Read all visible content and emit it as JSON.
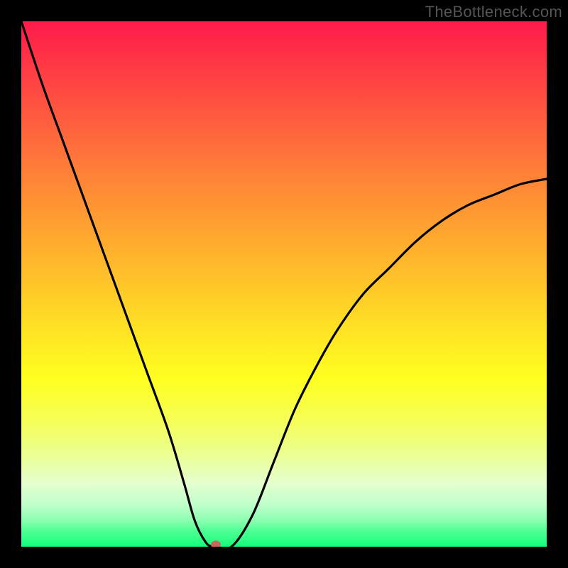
{
  "watermark": "TheBottleneck.com",
  "colors": {
    "frame_bg": "#000000",
    "curve_stroke": "#000000",
    "dot_fill": "#c56a5b",
    "gradient_top": "#ff1a4b",
    "gradient_bottom": "#12ff79"
  },
  "chart_data": {
    "type": "line",
    "title": "",
    "xlabel": "",
    "ylabel": "",
    "xlim": [
      0,
      1
    ],
    "ylim": [
      0,
      1
    ],
    "grid": false,
    "legend": false,
    "note": "Axes are unlabeled; values are normalized 0–1 from visual reading. Bottleneck-percentage style curve.",
    "marker": {
      "x": 0.37,
      "y": 0.0
    },
    "series": [
      {
        "name": "bottleneck-curve",
        "x": [
          0.0,
          0.04,
          0.08,
          0.12,
          0.16,
          0.2,
          0.24,
          0.28,
          0.31,
          0.33,
          0.35,
          0.365,
          0.4,
          0.44,
          0.48,
          0.52,
          0.56,
          0.6,
          0.65,
          0.7,
          0.75,
          0.8,
          0.85,
          0.9,
          0.95,
          1.0
        ],
        "y": [
          1.0,
          0.88,
          0.77,
          0.66,
          0.55,
          0.44,
          0.33,
          0.22,
          0.12,
          0.05,
          0.01,
          0.0,
          0.0,
          0.06,
          0.16,
          0.26,
          0.34,
          0.41,
          0.48,
          0.53,
          0.58,
          0.62,
          0.65,
          0.67,
          0.69,
          0.7
        ]
      }
    ]
  }
}
